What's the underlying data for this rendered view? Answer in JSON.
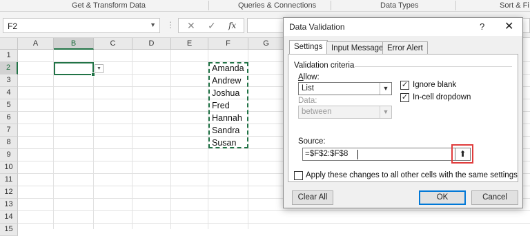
{
  "ribbon": {
    "groups": [
      "Get & Transform Data",
      "Queries & Connections",
      "Data Types",
      "Sort & Fi"
    ]
  },
  "formula_bar": {
    "name_box": "F2",
    "cancel_icon": "✕",
    "enter_icon": "✓",
    "fx_icon": "fx",
    "formula": ""
  },
  "sheet": {
    "columns": [
      "A",
      "B",
      "C",
      "D",
      "E",
      "F",
      "G"
    ],
    "rows": [
      "1",
      "2",
      "3",
      "4",
      "5",
      "6",
      "7",
      "8",
      "9",
      "10",
      "11",
      "12",
      "13",
      "14",
      "15"
    ],
    "active_cell": "B2",
    "names": [
      "Amanda",
      "Andrew",
      "Joshua",
      "Fred",
      "Hannah",
      "Sandra",
      "Susan"
    ]
  },
  "dialog": {
    "title": "Data Validation",
    "help": "?",
    "close": "✕",
    "tabs": [
      "Settings",
      "Input Message",
      "Error Alert"
    ],
    "active_tab": "Settings",
    "section_title": "Validation criteria",
    "allow_label": "Allow:",
    "allow_value": "List",
    "ignore_blank_label": "Ignore blank",
    "ignore_blank_checked": true,
    "in_cell_dropdown_label": "In-cell dropdown",
    "in_cell_dropdown_checked": true,
    "data_label": "Data:",
    "data_value": "between",
    "source_label": "Source:",
    "source_value": "=$F$2:$F$8",
    "apply_all_label": "Apply these changes to all other cells with the same settings",
    "apply_all_checked": false,
    "clear_all": "Clear All",
    "ok": "OK",
    "cancel": "Cancel"
  },
  "colors": {
    "excel_green": "#217346",
    "highlight_red": "#e03c3c",
    "default_button_blue": "#0078d7"
  }
}
